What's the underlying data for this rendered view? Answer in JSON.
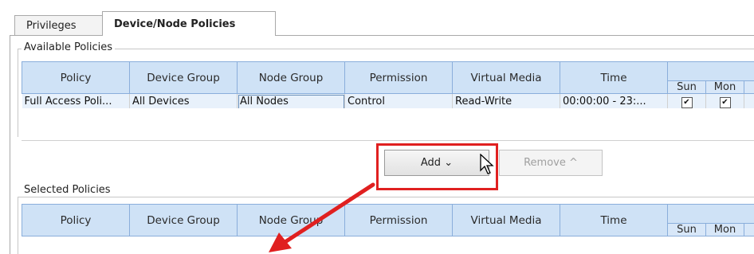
{
  "tabs": [
    {
      "label": "Privileges",
      "active": false
    },
    {
      "label": "Device/Node Policies",
      "active": true
    }
  ],
  "available": {
    "legend": "Available Policies",
    "columns": [
      "Policy",
      "Device Group",
      "Node Group",
      "Permission",
      "Virtual Media",
      "Time"
    ],
    "days": [
      "Sun",
      "Mon"
    ],
    "rows": [
      {
        "policy": "Full Access Poli...",
        "device_group": "All Devices",
        "node_group": "All Nodes",
        "permission": "Control",
        "virtual_media": "Read-Write",
        "time": "00:00:00 - 23:...",
        "sun": "✔",
        "mon": "✔"
      }
    ]
  },
  "buttons": {
    "add": "Add ⌄",
    "remove": "Remove ^"
  },
  "selected": {
    "legend": "Selected Policies",
    "columns": [
      "Policy",
      "Device Group",
      "Node Group",
      "Permission",
      "Virtual Media",
      "Time"
    ],
    "days": [
      "Sun",
      "Mon"
    ]
  },
  "colors": {
    "header_bg": "#cfe2f6",
    "highlight": "#e02020"
  }
}
